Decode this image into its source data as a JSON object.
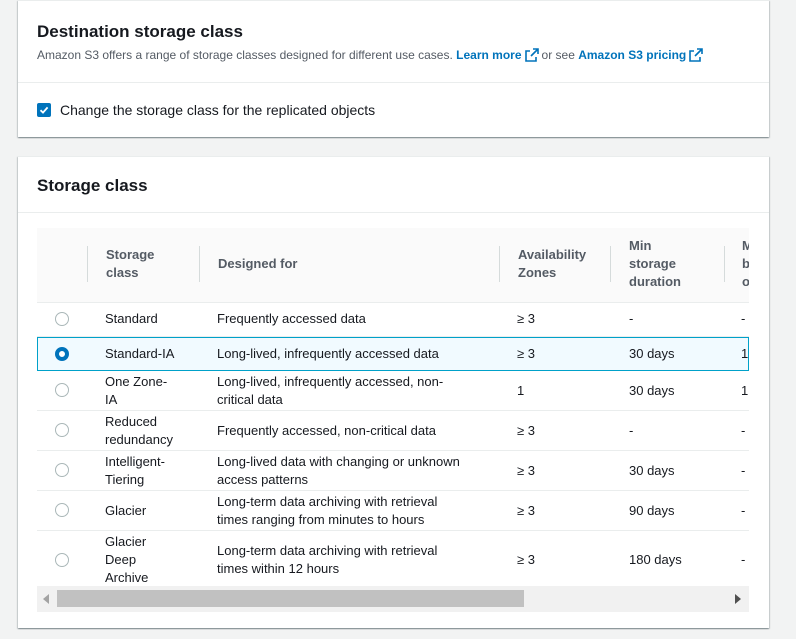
{
  "destination": {
    "title": "Destination storage class",
    "description": "Amazon S3 offers a range of storage classes designed for different use cases.",
    "learn_more": "Learn more",
    "or_see": "or see",
    "pricing_link": "Amazon S3 pricing",
    "checkbox_label": "Change the storage class for the replicated objects",
    "checkbox_checked": true
  },
  "storage_class": {
    "title": "Storage class",
    "columns": {
      "storage_class": [
        "Storage",
        "class"
      ],
      "designed_for": "Designed for",
      "availability_zones": [
        "Availability",
        "Zones"
      ],
      "min_storage_duration": [
        "Min",
        "storage",
        "duration"
      ],
      "next_col": [
        "M",
        "b",
        "o"
      ]
    },
    "rows": [
      {
        "name": [
          "Standard"
        ],
        "designed": [
          "Frequently accessed data"
        ],
        "az": "≥ 3",
        "min": "-",
        "next": "-",
        "selected": false
      },
      {
        "name": [
          "Standard-IA"
        ],
        "designed": [
          "Long-lived, infrequently accessed data"
        ],
        "az": "≥ 3",
        "min": "30 days",
        "next": "1",
        "selected": true
      },
      {
        "name": [
          "One Zone-",
          "IA"
        ],
        "designed": [
          "Long-lived, infrequently accessed, non-",
          "critical data"
        ],
        "az": "1",
        "min": "30 days",
        "next": "1",
        "selected": false
      },
      {
        "name": [
          "Reduced",
          "redundancy"
        ],
        "designed": [
          "Frequently accessed, non-critical data"
        ],
        "az": "≥ 3",
        "min": "-",
        "next": "-",
        "selected": false
      },
      {
        "name": [
          "Intelligent-",
          "Tiering"
        ],
        "designed": [
          "Long-lived data with changing or unknown",
          "access patterns"
        ],
        "az": "≥ 3",
        "min": "30 days",
        "next": "-",
        "selected": false
      },
      {
        "name": [
          "Glacier"
        ],
        "designed": [
          "Long-term data archiving with retrieval",
          "times ranging from minutes to hours"
        ],
        "az": "≥ 3",
        "min": "90 days",
        "next": "-",
        "selected": false
      },
      {
        "name": [
          "Glacier",
          "Deep",
          "Archive"
        ],
        "designed": [
          "Long-term data archiving with retrieval",
          "times within 12 hours"
        ],
        "az": "≥ 3",
        "min": "180 days",
        "next": "-",
        "selected": false
      }
    ]
  },
  "colors": {
    "accent": "#0073bb",
    "selected_bg": "#f1faff",
    "selected_border": "#00a1c9"
  }
}
